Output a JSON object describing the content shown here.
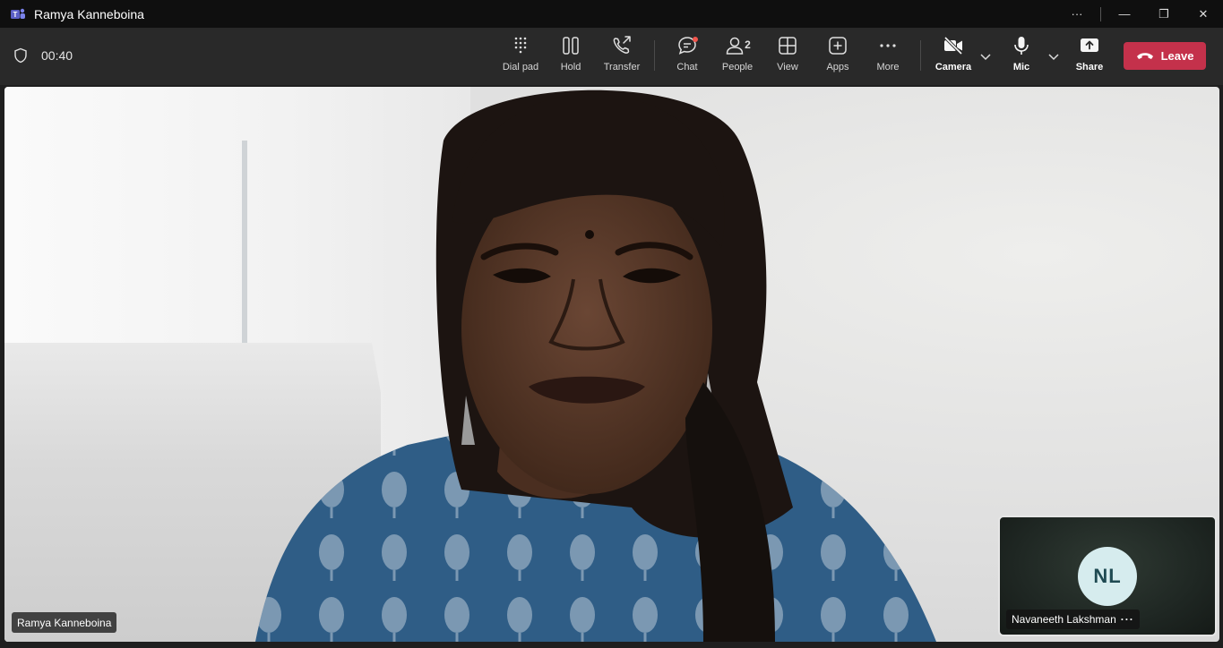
{
  "window": {
    "title": "Ramya Kanneboina",
    "more_glyph": "···",
    "minimize_glyph": "—",
    "restore_glyph": "❐",
    "close_glyph": "✕"
  },
  "call": {
    "timer": "00:40"
  },
  "toolbar": {
    "dialpad_label": "Dial pad",
    "hold_label": "Hold",
    "transfer_label": "Transfer",
    "chat_label": "Chat",
    "people_label": "People",
    "people_count": "2",
    "view_label": "View",
    "apps_label": "Apps",
    "more_label": "More",
    "camera_label": "Camera",
    "mic_label": "Mic",
    "share_label": "Share",
    "leave_label": "Leave"
  },
  "stage": {
    "main_participant": "Ramya Kanneboina"
  },
  "pip": {
    "initials": "NL",
    "name": "Navaneeth Lakshman",
    "more_glyph": "···"
  },
  "colors": {
    "leave": "#c4314b",
    "avatar_bg": "#d6ecee",
    "chat_badge": "#f2564d"
  }
}
